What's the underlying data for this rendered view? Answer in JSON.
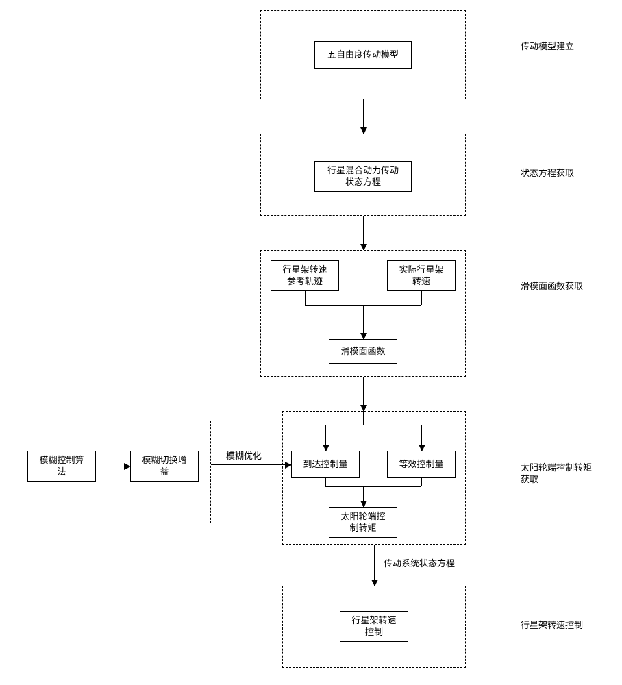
{
  "stage1_label": "传动模型建立",
  "stage1_box": "五自由度传动模型",
  "stage2_label": "状态方程获取",
  "stage2_box": "行星混合动力传动\n状态方程",
  "stage3_label": "滑模面函数获取",
  "stage3_box_left": "行星架转速\n参考轨迹",
  "stage3_box_right": "实际行星架\n转速",
  "stage3_box_bottom": "滑模面函数",
  "stage4_label": "太阳轮端控制转矩\n获取",
  "fuzzy_box1": "模糊控制算\n法",
  "fuzzy_box2": "模糊切换增\n益",
  "fuzzy_arrow_label": "模糊优化",
  "stage4_box_left": "到达控制量",
  "stage4_box_right": "等效控制量",
  "stage4_box_bottom": "太阳轮端控\n制转矩",
  "side_arrow_label": "传动系统状态方程",
  "stage5_label": "行星架转速控制",
  "stage5_box": "行星架转速\n控制",
  "chart_data": {
    "type": "table",
    "description": "Flowchart: planetary hybrid drivetrain fuzzy sliding-mode speed control",
    "nodes": [
      {
        "id": "s1",
        "label": "五自由度传动模型",
        "group": "传动模型建立"
      },
      {
        "id": "s2",
        "label": "行星混合动力传动状态方程",
        "group": "状态方程获取"
      },
      {
        "id": "s3a",
        "label": "行星架转速参考轨迹",
        "group": "滑模面函数获取"
      },
      {
        "id": "s3b",
        "label": "实际行星架转速",
        "group": "滑模面函数获取"
      },
      {
        "id": "s3c",
        "label": "滑模面函数",
        "group": "滑模面函数获取"
      },
      {
        "id": "f1",
        "label": "模糊控制算法",
        "group": "模糊优化"
      },
      {
        "id": "f2",
        "label": "模糊切换增益",
        "group": "模糊优化"
      },
      {
        "id": "s4a",
        "label": "到达控制量",
        "group": "太阳轮端控制转矩获取"
      },
      {
        "id": "s4b",
        "label": "等效控制量",
        "group": "太阳轮端控制转矩获取"
      },
      {
        "id": "s4c",
        "label": "太阳轮端控制转矩",
        "group": "太阳轮端控制转矩获取"
      },
      {
        "id": "s5",
        "label": "行星架转速控制",
        "group": "行星架转速控制"
      }
    ],
    "edges": [
      {
        "from": "s1",
        "to": "s2"
      },
      {
        "from": "s2",
        "to": "s3a"
      },
      {
        "from": "s2",
        "to": "s3b"
      },
      {
        "from": "s3a",
        "to": "s3c"
      },
      {
        "from": "s3b",
        "to": "s3c"
      },
      {
        "from": "s3c",
        "to": "s4a"
      },
      {
        "from": "s3c",
        "to": "s4b"
      },
      {
        "from": "f1",
        "to": "f2"
      },
      {
        "from": "f2",
        "to": "s4a",
        "label": "模糊优化"
      },
      {
        "from": "s4a",
        "to": "s4c"
      },
      {
        "from": "s4b",
        "to": "s4c"
      },
      {
        "from": "s4c",
        "to": "s5",
        "label": "传动系统状态方程"
      }
    ]
  }
}
